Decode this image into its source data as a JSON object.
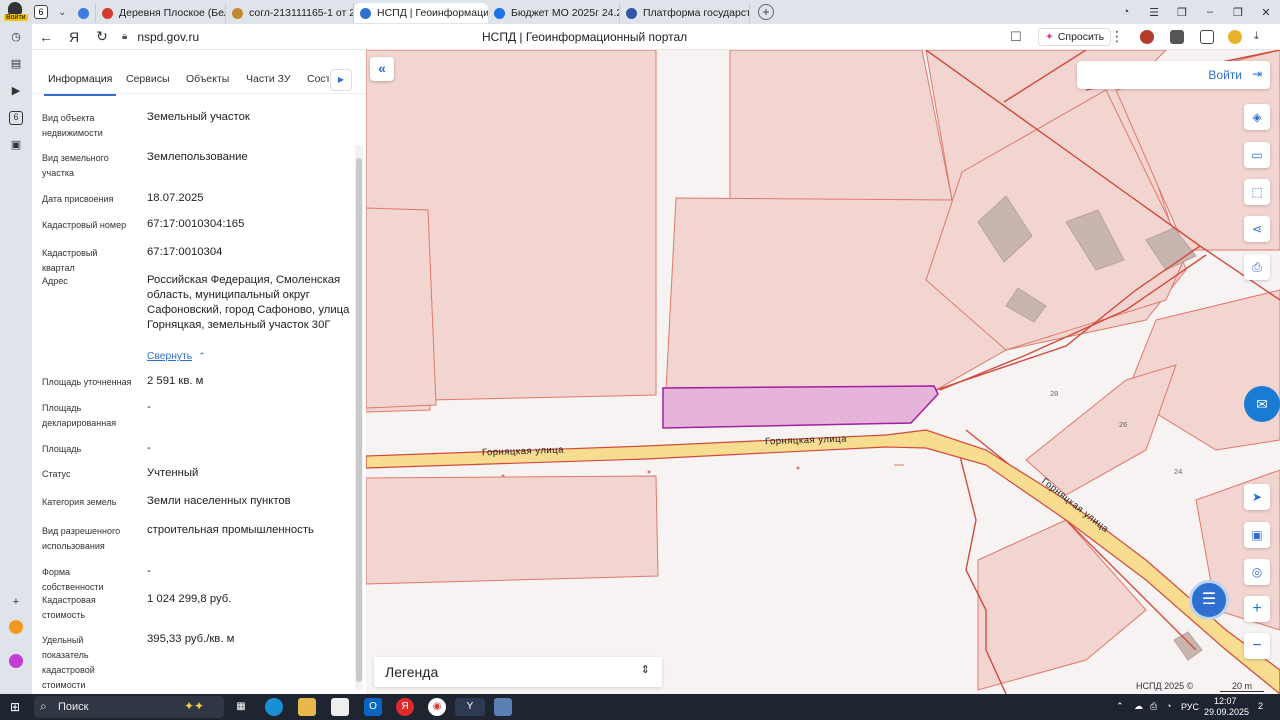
{
  "tabstrip": {
    "login_badge": "Войти",
    "tab_count": "6",
    "tabs": [
      {
        "label": "Деревня Плоское (Белен",
        "color": "#d33b2c"
      },
      {
        "label": "согл-213111165-1 от 29.0",
        "color": "#c08a2e"
      },
      {
        "label": "НСПД | Геоинформаци",
        "color": "#2f6fd0",
        "active": true
      },
      {
        "label": "Бюджет МО 2025г 24.2.2",
        "color": "#1a73e8"
      },
      {
        "label": "Платформа государствен",
        "color": "#3454a8"
      }
    ]
  },
  "address": {
    "url": "nspd.gov.ru",
    "title": "НСПД | Геоинформационный портал",
    "ask_label": "Спросить"
  },
  "panel": {
    "tabs": [
      "Информация",
      "Сервисы",
      "Объекты",
      "Части ЗУ",
      "Соста"
    ],
    "rows": [
      {
        "label": "Вид объекта недвижимости",
        "value": "Земельный участок"
      },
      {
        "label": "Вид земельного участка",
        "value": "Землепользование"
      },
      {
        "label": "Дата присвоения",
        "value": "18.07.2025"
      },
      {
        "label": "Кадастровый номер",
        "value": "67:17:0010304:165"
      },
      {
        "label": "Кадастровый квартал",
        "value": "67:17:0010304"
      },
      {
        "label": "Адрес",
        "value": "Российская Федерация, Смоленская область, муниципальный округ Сафоновский, город Сафоново, улица Горняцкая, земельный участок 30Г"
      },
      {
        "label": "Площадь уточненная",
        "value": "2 591 кв. м"
      },
      {
        "label": "Площадь декларированная",
        "value": "-"
      },
      {
        "label": "Площадь",
        "value": "-"
      },
      {
        "label": "Статус",
        "value": "Учтенный"
      },
      {
        "label": "Категория земель",
        "value": "Земли населенных пунктов"
      },
      {
        "label": "Вид разрешенного использования",
        "value": "строительная промышленность"
      },
      {
        "label": "Форма собственности",
        "value": "-"
      },
      {
        "label": "Кадастровая стоимость",
        "value": "1 024 299,8 руб."
      },
      {
        "label": "Удельный показатель кадастровой стоимости",
        "value": "395,33 руб./кв. м"
      }
    ],
    "collapse_label": "Свернуть"
  },
  "map": {
    "login_label": "Войти",
    "legend_label": "Легенда",
    "street_name": "Горняцкая улица",
    "houses": [
      "28",
      "26",
      "24"
    ],
    "copyright": "НСПД 2025 ©",
    "scale": "20 m"
  },
  "taskbar": {
    "search_label": "Поиск",
    "lang": "РУС",
    "time": "12:07",
    "date": "29.09.2025",
    "notif_count": "2"
  },
  "colors": {
    "accent": "#2f6fd0",
    "parcel_fill": "#f2d5d1",
    "parcel_stroke": "#e0786a",
    "selected_fill": "#e6b4da",
    "selected_stroke": "#a020a0",
    "road_fill": "#f8dc8f",
    "road_stroke": "#d24a3c"
  }
}
